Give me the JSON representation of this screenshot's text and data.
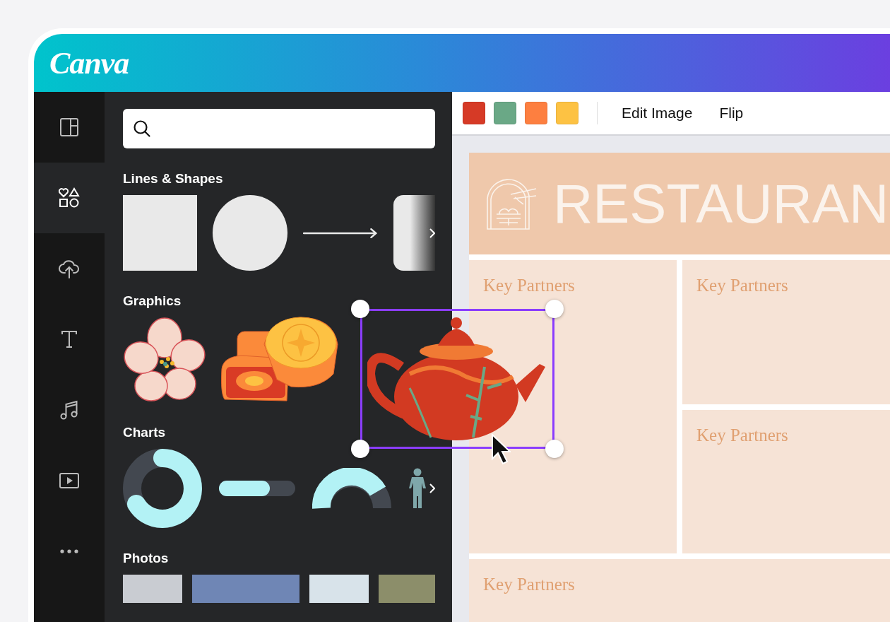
{
  "app": {
    "logo": "Canva"
  },
  "rail": [
    {
      "kind": "layout",
      "selected": false
    },
    {
      "kind": "elements",
      "selected": true
    },
    {
      "kind": "upload",
      "selected": false
    },
    {
      "kind": "text",
      "selected": false
    },
    {
      "kind": "audio",
      "selected": false
    },
    {
      "kind": "video",
      "selected": false
    },
    {
      "kind": "more",
      "selected": false
    }
  ],
  "sections": [
    {
      "title": "Lines & Shapes",
      "kind": "shapes"
    },
    {
      "title": "Graphics",
      "kind": "graphics"
    },
    {
      "title": "Charts",
      "kind": "charts"
    },
    {
      "title": "Photos",
      "kind": "photos"
    }
  ],
  "toolbar": {
    "swatches": [
      {
        "color": "#d63a26"
      },
      {
        "color": "#6aa886"
      },
      {
        "color": "#fd7f40"
      },
      {
        "color": "#fdc243"
      }
    ],
    "actions": [
      "Edit Image",
      "Flip"
    ]
  },
  "design": {
    "title": "RESTAURAN",
    "cells": [
      "Key Partners",
      "Key Partners",
      "Key Partners",
      "Key Partners"
    ]
  }
}
